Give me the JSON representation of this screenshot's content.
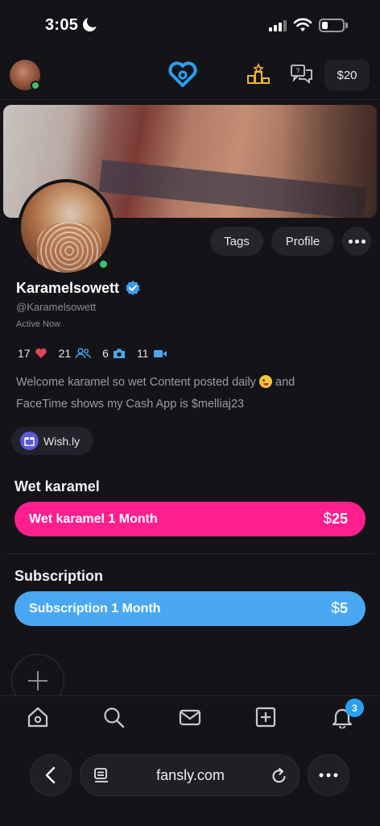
{
  "status_bar": {
    "time": "3:05"
  },
  "header": {
    "balance": "$20"
  },
  "profile": {
    "display_name": "Karamelsowett",
    "handle": "@Karamelsowett",
    "status": "Active Now",
    "buttons": {
      "tags": "Tags",
      "profile": "Profile"
    },
    "stats": {
      "likes": "17",
      "followers": "21",
      "photos": "6",
      "videos": "11"
    },
    "bio_line1": "Welcome karamel so wet Content posted daily",
    "bio_line1_end": "and",
    "bio_line2": "FaceTime shows my Cash App is $melliaj23",
    "link_label": "Wish.ly"
  },
  "tiers": [
    {
      "section_title": "Wet karamel",
      "label": "Wet karamel 1 Month",
      "currency": "$",
      "price": "25",
      "color": "#ff1f8e"
    },
    {
      "section_title": "Subscription",
      "label": "Subscription 1 Month",
      "currency": "$",
      "price": "5",
      "color": "#4aa8f2"
    }
  ],
  "bottom_nav": {
    "notification_count": "3"
  },
  "browser": {
    "url": "fansly.com"
  }
}
